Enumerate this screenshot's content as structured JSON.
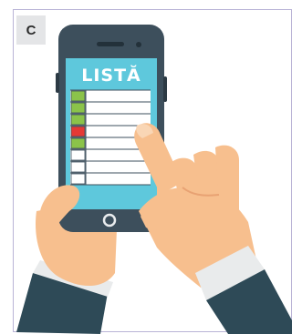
{
  "panel": {
    "badge_label": "C"
  },
  "phone": {
    "screen_title": "LISTĂ",
    "checklist_status_colors": [
      "#8bc34a",
      "#8bc34a",
      "#8bc34a",
      "#e53935",
      "#8bc34a",
      "#ffffff",
      "#ffffff",
      "#ffffff"
    ]
  },
  "colors": {
    "phone_body": "#3d4f5c",
    "screen": "#5ec8dc",
    "skin": "#f7bf8e",
    "skin_shadow": "#e8a273",
    "sleeve": "#2e4a57",
    "cuff": "#e9ebec"
  }
}
